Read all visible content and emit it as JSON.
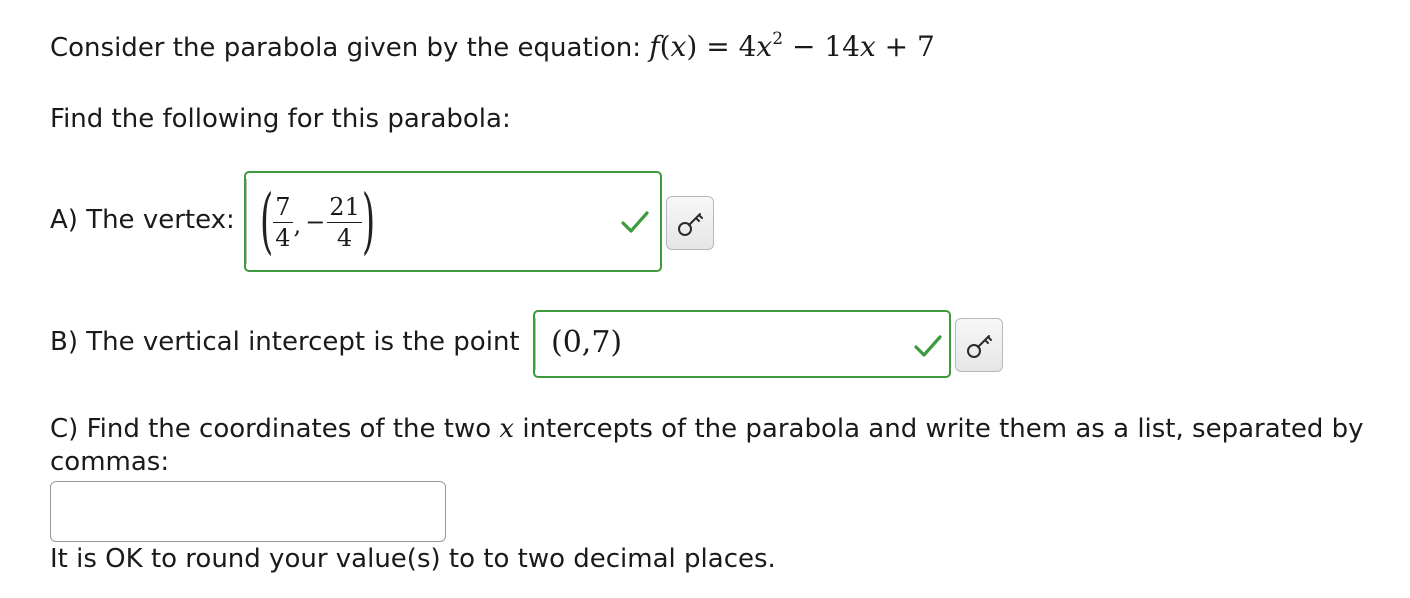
{
  "problem": {
    "intro_text": "Consider the parabola given by the equation: ",
    "equation": {
      "lhs_fn": "f",
      "lhs_var": "x",
      "equals": "=",
      "coef_a": "4",
      "var_a": "x",
      "exp_a": "2",
      "minus": "−",
      "coef_b": "14",
      "var_b": "x",
      "plus": "+",
      "const": "7"
    },
    "instruction": "Find the following for this parabola:"
  },
  "part_a": {
    "label": "A) The vertex:",
    "answer": {
      "open_paren": "(",
      "x_num": "7",
      "x_den": "4",
      "comma": ",",
      "neg": "−",
      "y_num": "21",
      "y_den": "4",
      "close_paren": ")"
    },
    "status": "correct",
    "status_icon": "check-icon",
    "key_icon": "key-icon"
  },
  "part_b": {
    "label": "B) The vertical intercept is the point",
    "answer": "(0,7)",
    "status": "correct",
    "status_icon": "check-icon",
    "key_icon": "key-icon"
  },
  "part_c": {
    "label_before": "C) Find the coordinates of the two ",
    "label_var": "x",
    "label_after": " intercepts of the parabola and write them as a list, separated by",
    "label_line2": "commas:",
    "input_value": "",
    "note": "It is OK to round your value(s) to to two decimal places."
  },
  "colors": {
    "correct_green": "#3d9a3d",
    "text": "#1a1a1a",
    "input_border": "#9a9a9a"
  }
}
